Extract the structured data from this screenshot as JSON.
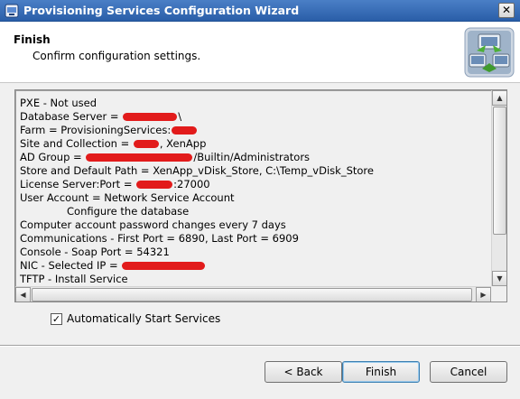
{
  "window": {
    "title": "Provisioning Services Configuration Wizard",
    "close_glyph": "✕"
  },
  "header": {
    "title": "Finish",
    "subtitle": "Confirm configuration settings."
  },
  "summary": {
    "lines": [
      {
        "text": "PXE - Not used"
      },
      {
        "text": "Database Server = ",
        "suffix": "\\"
      },
      {
        "text": "Farm = ProvisioningServices:"
      },
      {
        "text": "Site and Collection = ",
        "suffix": ", XenApp"
      },
      {
        "text": "AD Group = ",
        "suffix": "/Builtin/Administrators"
      },
      {
        "text": "Store and Default Path = XenApp_vDisk_Store, C:\\Temp_vDisk_Store"
      },
      {
        "text": "License Server:Port = ",
        "suffix": ":27000"
      },
      {
        "text": "User Account = Network Service Account"
      },
      {
        "text": "Configure the database",
        "indent": true
      },
      {
        "text": "Computer account password changes every 7 days"
      },
      {
        "text": "Communications - First Port = 6890, Last Port = 6909"
      },
      {
        "text": "Console - Soap Port = 54321"
      },
      {
        "text": "NIC - Selected IP = "
      },
      {
        "text": "TFTP - Install Service"
      }
    ],
    "redaction_color": "#e21b1b"
  },
  "auto_start": {
    "checked": true,
    "check_glyph": "✓",
    "label": "Automatically Start Services"
  },
  "buttons": {
    "back": "< Back",
    "finish": "Finish",
    "cancel": "Cancel"
  },
  "scrollbar": {
    "up": "▲",
    "down": "▼",
    "left": "◀",
    "right": "▶"
  },
  "colors": {
    "titlebar": "#2a5ea8",
    "title_text": "#ffffff",
    "default_button_border": "#3c7fb1"
  },
  "icons": {
    "app": "wizard-app-icon",
    "header": "network-computers-icon"
  }
}
